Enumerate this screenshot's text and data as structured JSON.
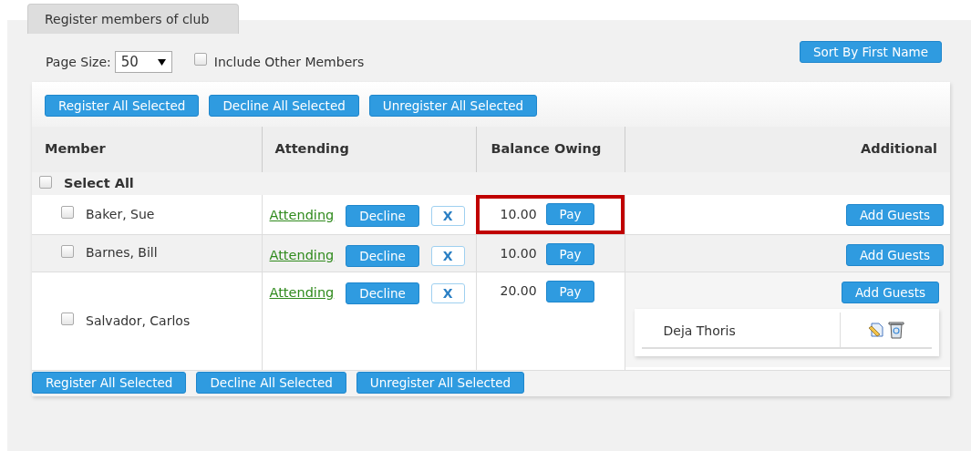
{
  "tab": {
    "label": "Register members of club"
  },
  "page_size": {
    "label": "Page Size:",
    "value": "50"
  },
  "include_other": {
    "label": "Include Other Members",
    "checked": false
  },
  "sort_button": "Sort By First Name",
  "bulk_buttons_top": [
    "Register All Selected",
    "Decline All Selected",
    "Unregister All Selected"
  ],
  "bulk_buttons_bottom": [
    "Register All Selected",
    "Decline All Selected",
    "Unregister All Selected"
  ],
  "columns": [
    "Member",
    "Attending",
    "Balance Owing",
    "Additional"
  ],
  "select_all": {
    "label": "Select All",
    "checked": false
  },
  "rows": [
    {
      "name": "Baker, Sue",
      "checked": false,
      "status": "Attending",
      "decline": "Decline",
      "remove": "X",
      "balance": "10.00",
      "pay": "Pay",
      "highlighted": true,
      "add_guests": "Add Guests"
    },
    {
      "name": "Barnes, Bill",
      "checked": false,
      "status": "Attending",
      "decline": "Decline",
      "remove": "X",
      "balance": "10.00",
      "pay": "Pay",
      "highlighted": false,
      "add_guests": "Add Guests"
    },
    {
      "name": "Salvador, Carlos",
      "checked": false,
      "status": "Attending",
      "decline": "Decline",
      "remove": "X",
      "balance": "20.00",
      "pay": "Pay",
      "highlighted": false,
      "add_guests": "Add Guests",
      "guests": [
        {
          "name": "Deja Thoris"
        }
      ]
    }
  ]
}
